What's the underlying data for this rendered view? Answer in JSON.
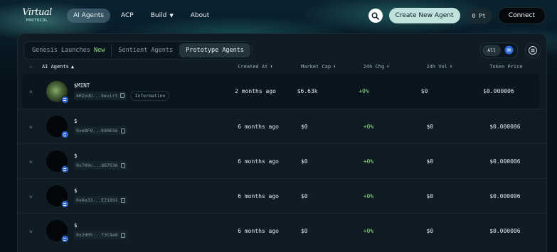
{
  "header": {
    "logo_script": "Virtual",
    "logo_sub": "PROTOCOL",
    "nav": [
      {
        "label": "AI Agents",
        "active": true
      },
      {
        "label": "ACP"
      },
      {
        "label": "Build",
        "has_dropdown": true
      },
      {
        "label": "About"
      }
    ],
    "create_label": "Create New Agent",
    "points_label": "0 Pt",
    "connect_label": "Connect"
  },
  "tabs": [
    {
      "label": "Genesis Launches",
      "badge": "New"
    },
    {
      "label": "Sentient Agents"
    },
    {
      "label": "Prototype Agents",
      "active": true
    }
  ],
  "filter": {
    "all_label": "All"
  },
  "table": {
    "columns": {
      "agent": "AI Agents",
      "created": "Created At",
      "mcap": "Market Cap",
      "chg": "24h Chg",
      "vol": "24h Vol",
      "price": "Token Price"
    },
    "rows": [
      {
        "name": "$MINT",
        "address": "4HZodU...9evirt",
        "tag": "Information",
        "created": "2 months ago",
        "mcap": "$6.63k",
        "chg": "+0%",
        "vol": "$0",
        "price": "$0.000006",
        "has_image": true
      },
      {
        "name": "$",
        "address": "0xe8F9...690E56",
        "created": "6 months ago",
        "mcap": "$0",
        "chg": "+0%",
        "vol": "$0",
        "price": "$0.000006"
      },
      {
        "name": "$",
        "address": "0x709c...d07036",
        "created": "6 months ago",
        "mcap": "$0",
        "chg": "+0%",
        "vol": "$0",
        "price": "$0.000006"
      },
      {
        "name": "$",
        "address": "0x8e33...E21891",
        "created": "6 months ago",
        "mcap": "$0",
        "chg": "+0%",
        "vol": "$0",
        "price": "$0.000006"
      },
      {
        "name": "$",
        "address": "0x2d05...73C8e8",
        "created": "6 months ago",
        "mcap": "$0",
        "chg": "+0%",
        "vol": "$0",
        "price": "$0.000006"
      }
    ]
  },
  "colors": {
    "accent_green": "#8fe07f",
    "chain_blue": "#2d6ad6",
    "create_button": "#bfe3dc"
  }
}
